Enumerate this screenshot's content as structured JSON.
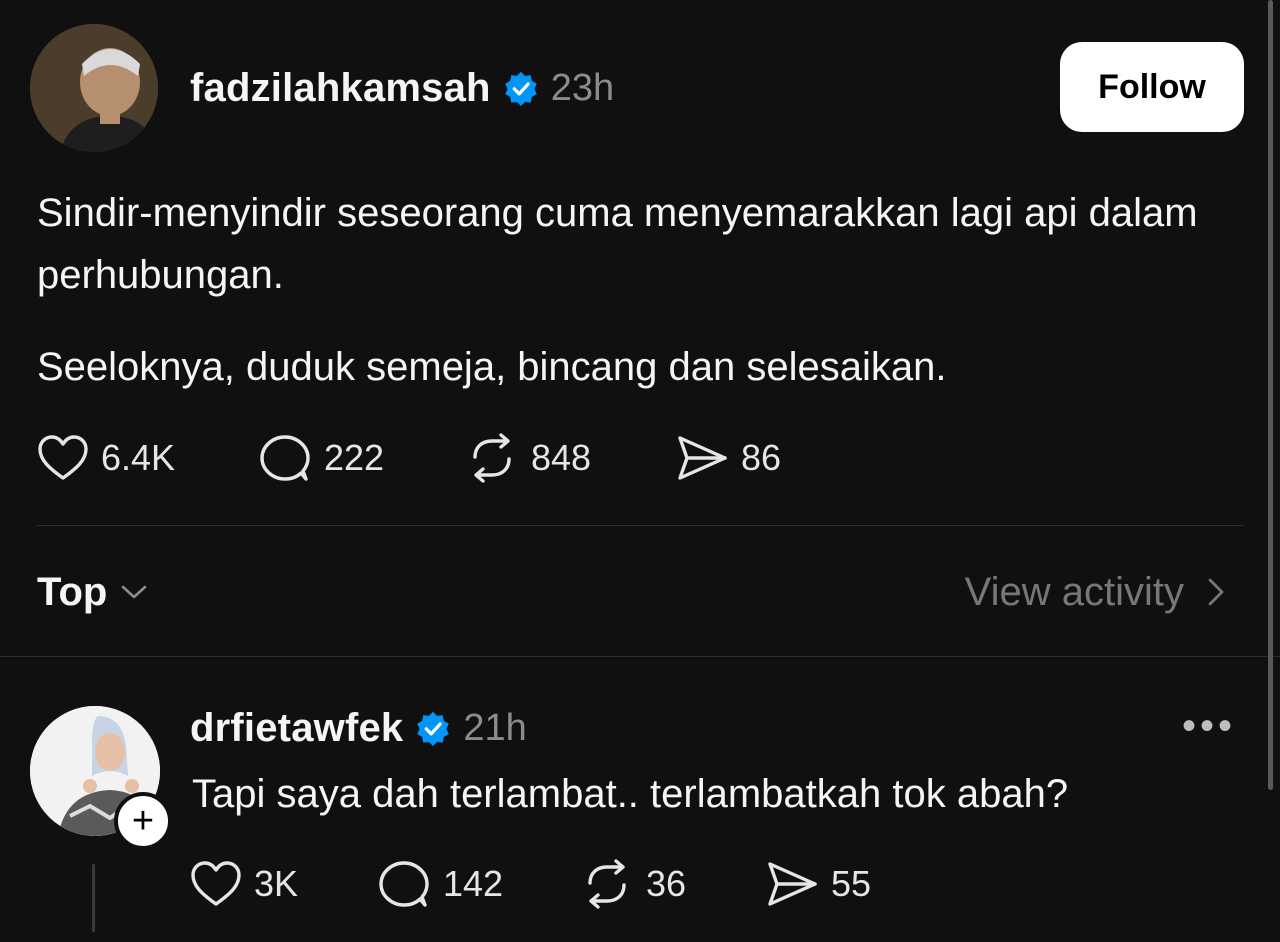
{
  "post": {
    "username": "fadzilahkamsah",
    "time": "23h",
    "follow_label": "Follow",
    "paragraphs": [
      "Sindir-menyindir seseorang cuma menyemarakkan lagi api dalam perhubungan.",
      "Seeloknya, duduk semeja, bincang dan selesaikan."
    ],
    "stats": {
      "likes": "6.4K",
      "replies": "222",
      "reposts": "848",
      "shares": "86"
    }
  },
  "replies_header": {
    "sort_label": "Top",
    "view_activity": "View activity"
  },
  "reply": {
    "username": "drfietawfek",
    "time": "21h",
    "text": "Tapi saya dah terlambat.. terlambatkah tok abah?",
    "more_label": "•••",
    "plus_label": "+",
    "stats": {
      "likes": "3K",
      "replies": "142",
      "reposts": "36",
      "shares": "55"
    }
  },
  "colors": {
    "background": "#101010",
    "verified": "#0095f6",
    "secondary_text": "#8c8c8c"
  }
}
